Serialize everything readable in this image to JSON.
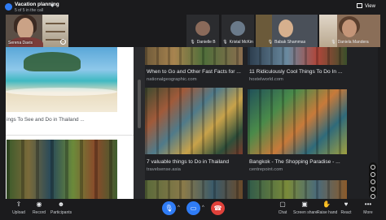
{
  "meeting": {
    "title": "Vacation planning",
    "subtitle": "5 of 5 in the call",
    "view_label": "View"
  },
  "self_view": {
    "name": "Serena Davis"
  },
  "participants": [
    {
      "name": "Danielle B"
    },
    {
      "name": "Kristal McKin"
    },
    {
      "name": "Babak Shammas"
    },
    {
      "name": "Daniela Mandera"
    }
  ],
  "shared_content": {
    "left_doc": {
      "text": "ings To See and Do in Thailand ..."
    },
    "results": [
      {
        "title": "When to Go and Other Fast Facts for ...",
        "site": "nationalgeographic.com"
      },
      {
        "title": "11 Ridiculously Cool Things To Do In ...",
        "site": "hostelworld.com"
      },
      {
        "title": "7 valuable things to Do in Thailand",
        "site": "travelsense.asia"
      },
      {
        "title": "Bangkok - The Shopping Paradise - ...",
        "site": "centrepoint.com"
      }
    ]
  },
  "toolbar": {
    "upload_label": "Upload",
    "record_label": "Record",
    "participants_label": "Participants",
    "chat_label": "Chat",
    "screen_share_label": "Screen share",
    "raise_hand_label": "Raise hand",
    "react_label": "React",
    "more_label": "More"
  },
  "colors": {
    "accent": "#2f7cf6",
    "end_call": "#e0413a",
    "background": "#1b1b1d"
  }
}
